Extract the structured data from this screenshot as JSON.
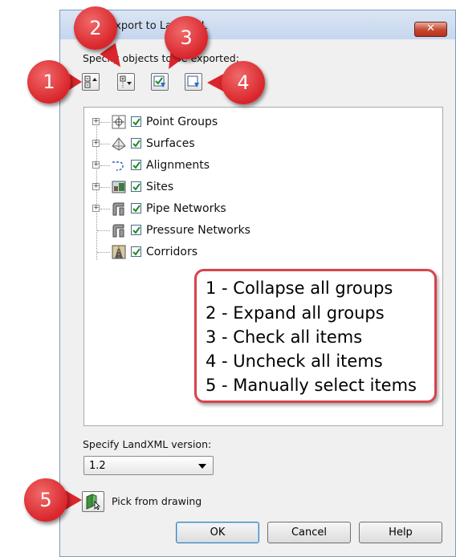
{
  "window": {
    "title": "Export to LandXML",
    "close_label": "✕"
  },
  "objects_label": "Specify objects to be exported:",
  "toolbar": [
    {
      "name": "collapse-all-button",
      "icon": "collapse-all-icon"
    },
    {
      "name": "expand-all-button",
      "icon": "expand-all-icon"
    },
    {
      "name": "check-all-button",
      "icon": "check-all-icon"
    },
    {
      "name": "uncheck-all-button",
      "icon": "uncheck-all-icon"
    }
  ],
  "tree": {
    "items": [
      {
        "label": "Point Groups",
        "checked": true,
        "expandable": true,
        "icon": "point-groups-icon"
      },
      {
        "label": "Surfaces",
        "checked": true,
        "expandable": true,
        "icon": "surfaces-icon"
      },
      {
        "label": "Alignments",
        "checked": true,
        "expandable": true,
        "icon": "alignments-icon"
      },
      {
        "label": "Sites",
        "checked": true,
        "expandable": true,
        "icon": "sites-icon"
      },
      {
        "label": "Pipe Networks",
        "checked": true,
        "expandable": true,
        "icon": "pipe-networks-icon"
      },
      {
        "label": "Pressure Networks",
        "checked": true,
        "expandable": false,
        "icon": "pressure-networks-icon"
      },
      {
        "label": "Corridors",
        "checked": true,
        "expandable": false,
        "icon": "corridors-icon"
      }
    ]
  },
  "callout": {
    "lines": [
      "1 - Collapse all groups",
      "2 - Expand all groups",
      "3 - Check all items",
      "4 - Uncheck all items",
      "5 - Manually select items"
    ]
  },
  "version": {
    "label": "Specify LandXML version:",
    "selected": "1.2"
  },
  "pick": {
    "label": "Pick from drawing"
  },
  "buttons": {
    "ok": "OK",
    "cancel": "Cancel",
    "help": "Help"
  },
  "badges": [
    "1",
    "2",
    "3",
    "4",
    "5"
  ],
  "colors": {
    "badge_red": "#d9252b",
    "callout_border": "#d9434b",
    "check_green": "#1e8a1e"
  }
}
